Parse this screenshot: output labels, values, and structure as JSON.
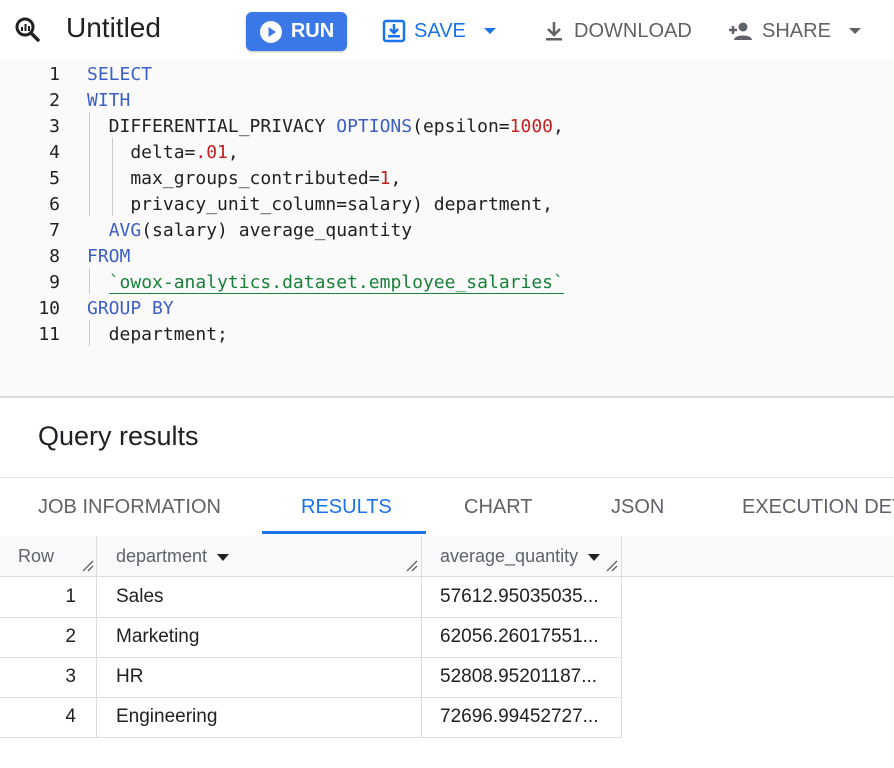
{
  "toolbar": {
    "title": "Untitled",
    "run_label": "RUN",
    "save_label": "SAVE",
    "download_label": "DOWNLOAD",
    "share_label": "SHARE",
    "accent_color": "#1a73e8",
    "run_color": "#3b78e7"
  },
  "editor": {
    "line_numbers": [
      "1",
      "2",
      "3",
      "4",
      "5",
      "6",
      "7",
      "8",
      "9",
      "10",
      "11"
    ],
    "lines": [
      [
        {
          "t": "SELECT",
          "c": "kw"
        }
      ],
      [
        {
          "t": "WITH",
          "c": "kw"
        }
      ],
      [
        {
          "t": "  DIFFERENTIAL_PRIVACY ",
          "c": ""
        },
        {
          "t": "OPTIONS",
          "c": "kw"
        },
        {
          "t": "(epsilon=",
          "c": ""
        },
        {
          "t": "1000",
          "c": "num"
        },
        {
          "t": ",",
          "c": ""
        }
      ],
      [
        {
          "t": "    delta=",
          "c": ""
        },
        {
          "t": ".01",
          "c": "num"
        },
        {
          "t": ",",
          "c": ""
        }
      ],
      [
        {
          "t": "    max_groups_contributed=",
          "c": ""
        },
        {
          "t": "1",
          "c": "num"
        },
        {
          "t": ",",
          "c": ""
        }
      ],
      [
        {
          "t": "    privacy_unit_column=salary) department,",
          "c": ""
        }
      ],
      [
        {
          "t": "  ",
          "c": ""
        },
        {
          "t": "AVG",
          "c": "kw"
        },
        {
          "t": "(salary) average_quantity",
          "c": ""
        }
      ],
      [
        {
          "t": "FROM",
          "c": "kw"
        }
      ],
      [
        {
          "t": "  ",
          "c": ""
        },
        {
          "t": "`owox-analytics.dataset.employee_salaries`",
          "c": "str"
        }
      ],
      [
        {
          "t": "GROUP BY",
          "c": "kw"
        }
      ],
      [
        {
          "t": "  department;",
          "c": ""
        }
      ]
    ]
  },
  "results": {
    "title": "Query results",
    "tabs": [
      "JOB INFORMATION",
      "RESULTS",
      "CHART",
      "JSON",
      "EXECUTION DET"
    ],
    "active_tab": "RESULTS",
    "columns": [
      "Row",
      "department",
      "average_quantity"
    ],
    "rows": [
      {
        "row": "1",
        "department": "Sales",
        "average_quantity": "57612.95035035..."
      },
      {
        "row": "2",
        "department": "Marketing",
        "average_quantity": "62056.26017551..."
      },
      {
        "row": "3",
        "department": "HR",
        "average_quantity": "52808.95201187..."
      },
      {
        "row": "4",
        "department": "Engineering",
        "average_quantity": "72696.99452727..."
      }
    ]
  }
}
